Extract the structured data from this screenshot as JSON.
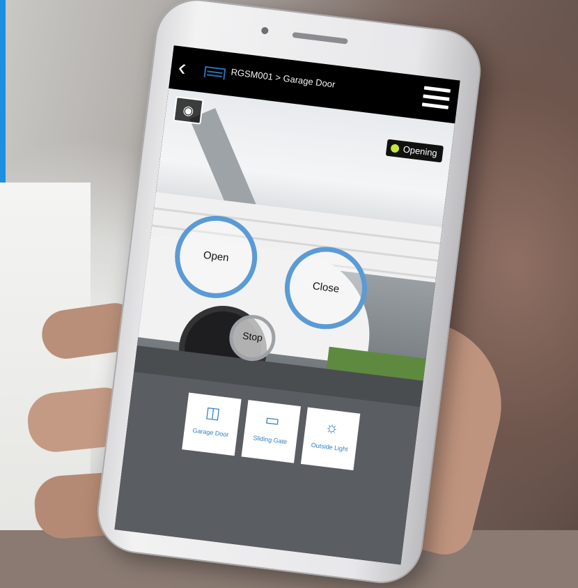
{
  "header": {
    "back_icon": "chevron-left-icon",
    "device_icon": "garage-door-icon",
    "breadcrumb": "RGSM001 > Garage Door",
    "menu_icon": "hamburger-menu-icon"
  },
  "camera": {
    "snapshot_icon": "camera-snapshot-icon",
    "status_label": "Opening",
    "status_color": "#c9e63a"
  },
  "controls": {
    "open_label": "Open",
    "close_label": "Close",
    "stop_label": "Stop",
    "ring_color": "#5b9bd5"
  },
  "devices": [
    {
      "label": "Garage Door",
      "icon": "garage-door-user-icon"
    },
    {
      "label": "Sliding Gate",
      "icon": "sliding-gate-user-icon"
    },
    {
      "label": "Outside Light",
      "icon": "light-bulb-user-icon"
    }
  ]
}
